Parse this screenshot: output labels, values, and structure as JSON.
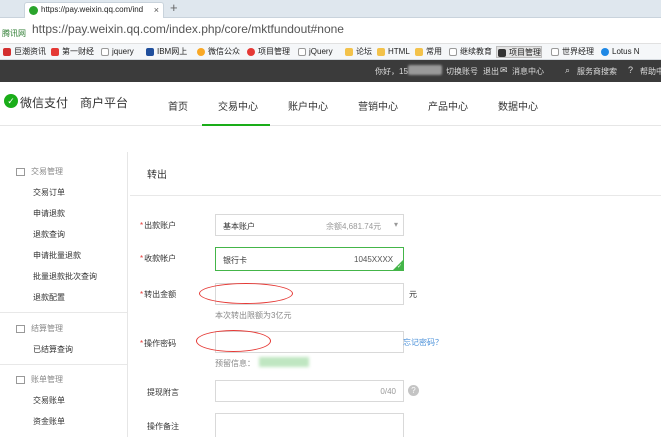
{
  "browser": {
    "tab_title": "https://pay.weixin.qq.com/ind",
    "tab_close": "×",
    "new_tab": "+",
    "site_tag": "腾讯网",
    "url": "https://pay.weixin.qq.com/index.php/core/mktfundout#none",
    "bookmarks": [
      "巨潮资讯",
      "第一财经",
      "jquery",
      "IBM网上",
      "微信公众",
      "项目管理",
      "jQuery",
      "论坛",
      "HTML",
      "常用",
      "继续教育",
      "项目管理",
      "世界经理",
      "Lotus N"
    ]
  },
  "topbar": {
    "greeting": "你好，15",
    "switch_account": "切换账号",
    "logout": "退出",
    "messages": "消息中心",
    "search": "服务商搜索",
    "help": "帮助中"
  },
  "header": {
    "logo": "微信支付",
    "platform": "商户平台",
    "nav": [
      "首页",
      "交易中心",
      "账户中心",
      "营销中心",
      "产品中心",
      "数据中心"
    ]
  },
  "sidebar": {
    "group1_title": "交易管理",
    "group1_items": [
      "交易订单",
      "申请退款",
      "退款查询",
      "申请批量退款",
      "批量退款批次查询",
      "退款配置"
    ],
    "group2_title": "结算管理",
    "group2_items": [
      "已结算查询"
    ],
    "group3_title": "账单管理",
    "group3_items": [
      "交易账单",
      "资金账单"
    ]
  },
  "main": {
    "title": "转出",
    "from_account_label": "出款账户",
    "from_account_value": "基本账户",
    "balance": "余额4,681.74元",
    "to_account_label": "收款帐户",
    "to_account_value": "银行卡",
    "card_number": "1045XXXX",
    "amount_label": "转出金额",
    "amount_unit": "元",
    "amount_hint": "本次转出限额为3亿元",
    "password_label": "操作密码",
    "forgot_password": "忘记密码？",
    "reserved_info": "预留信息：",
    "remark_label": "提现附言",
    "remark_counter": "0/40",
    "note_label": "操作备注",
    "required_mark": "*",
    "help_mark": "?"
  }
}
